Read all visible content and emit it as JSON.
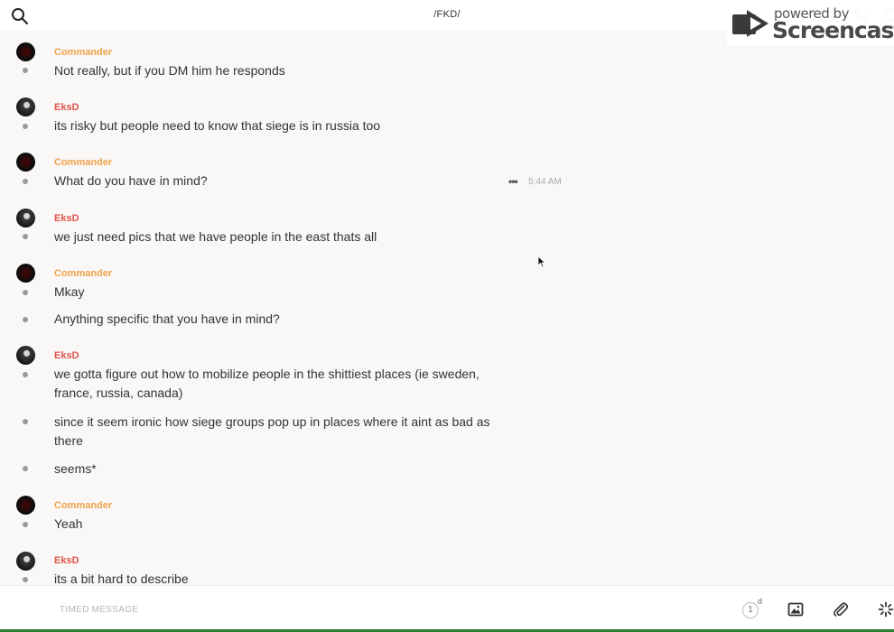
{
  "header": {
    "channel_title": "/FKD/",
    "watermark_small": "powered by",
    "watermark_big": "Screencastify"
  },
  "messages": [
    {
      "author": "Commander",
      "text": "Not really, but if you DM him he responds"
    },
    {
      "author": "EksD",
      "text": "its risky but people need to know that siege is in russia too"
    },
    {
      "author": "Commander",
      "text": "What do you have in mind?",
      "time": "5:44 AM"
    },
    {
      "author": "EksD",
      "text": "we just need pics that we have people in the east thats all"
    },
    {
      "author": "Commander",
      "text": "Mkay"
    },
    {
      "author": null,
      "text": "Anything specific that you have in mind?"
    },
    {
      "author": "EksD",
      "text": "we gotta figure out how to mobilize people in the shittiest places (ie sweden, france, russia, canada)"
    },
    {
      "author": null,
      "text": "since it seem ironic how siege groups pop up in places where it aint as bad as there"
    },
    {
      "author": null,
      "text": "seems*"
    },
    {
      "author": "Commander",
      "text": "Yeah"
    },
    {
      "author": "EksD",
      "text": "its a bit hard to describe"
    }
  ],
  "hover_menu": "•••",
  "composer": {
    "placeholder": "TIMED MESSAGE",
    "timer_value": "1",
    "timer_unit": "d"
  },
  "colors": {
    "commander": "#f0a24a",
    "eksd": "#e0524a",
    "background": "#f9f8f7"
  },
  "icons": [
    "search-icon",
    "phone-icon",
    "info-icon",
    "image-icon",
    "paperclip-icon",
    "sparkle-icon"
  ]
}
